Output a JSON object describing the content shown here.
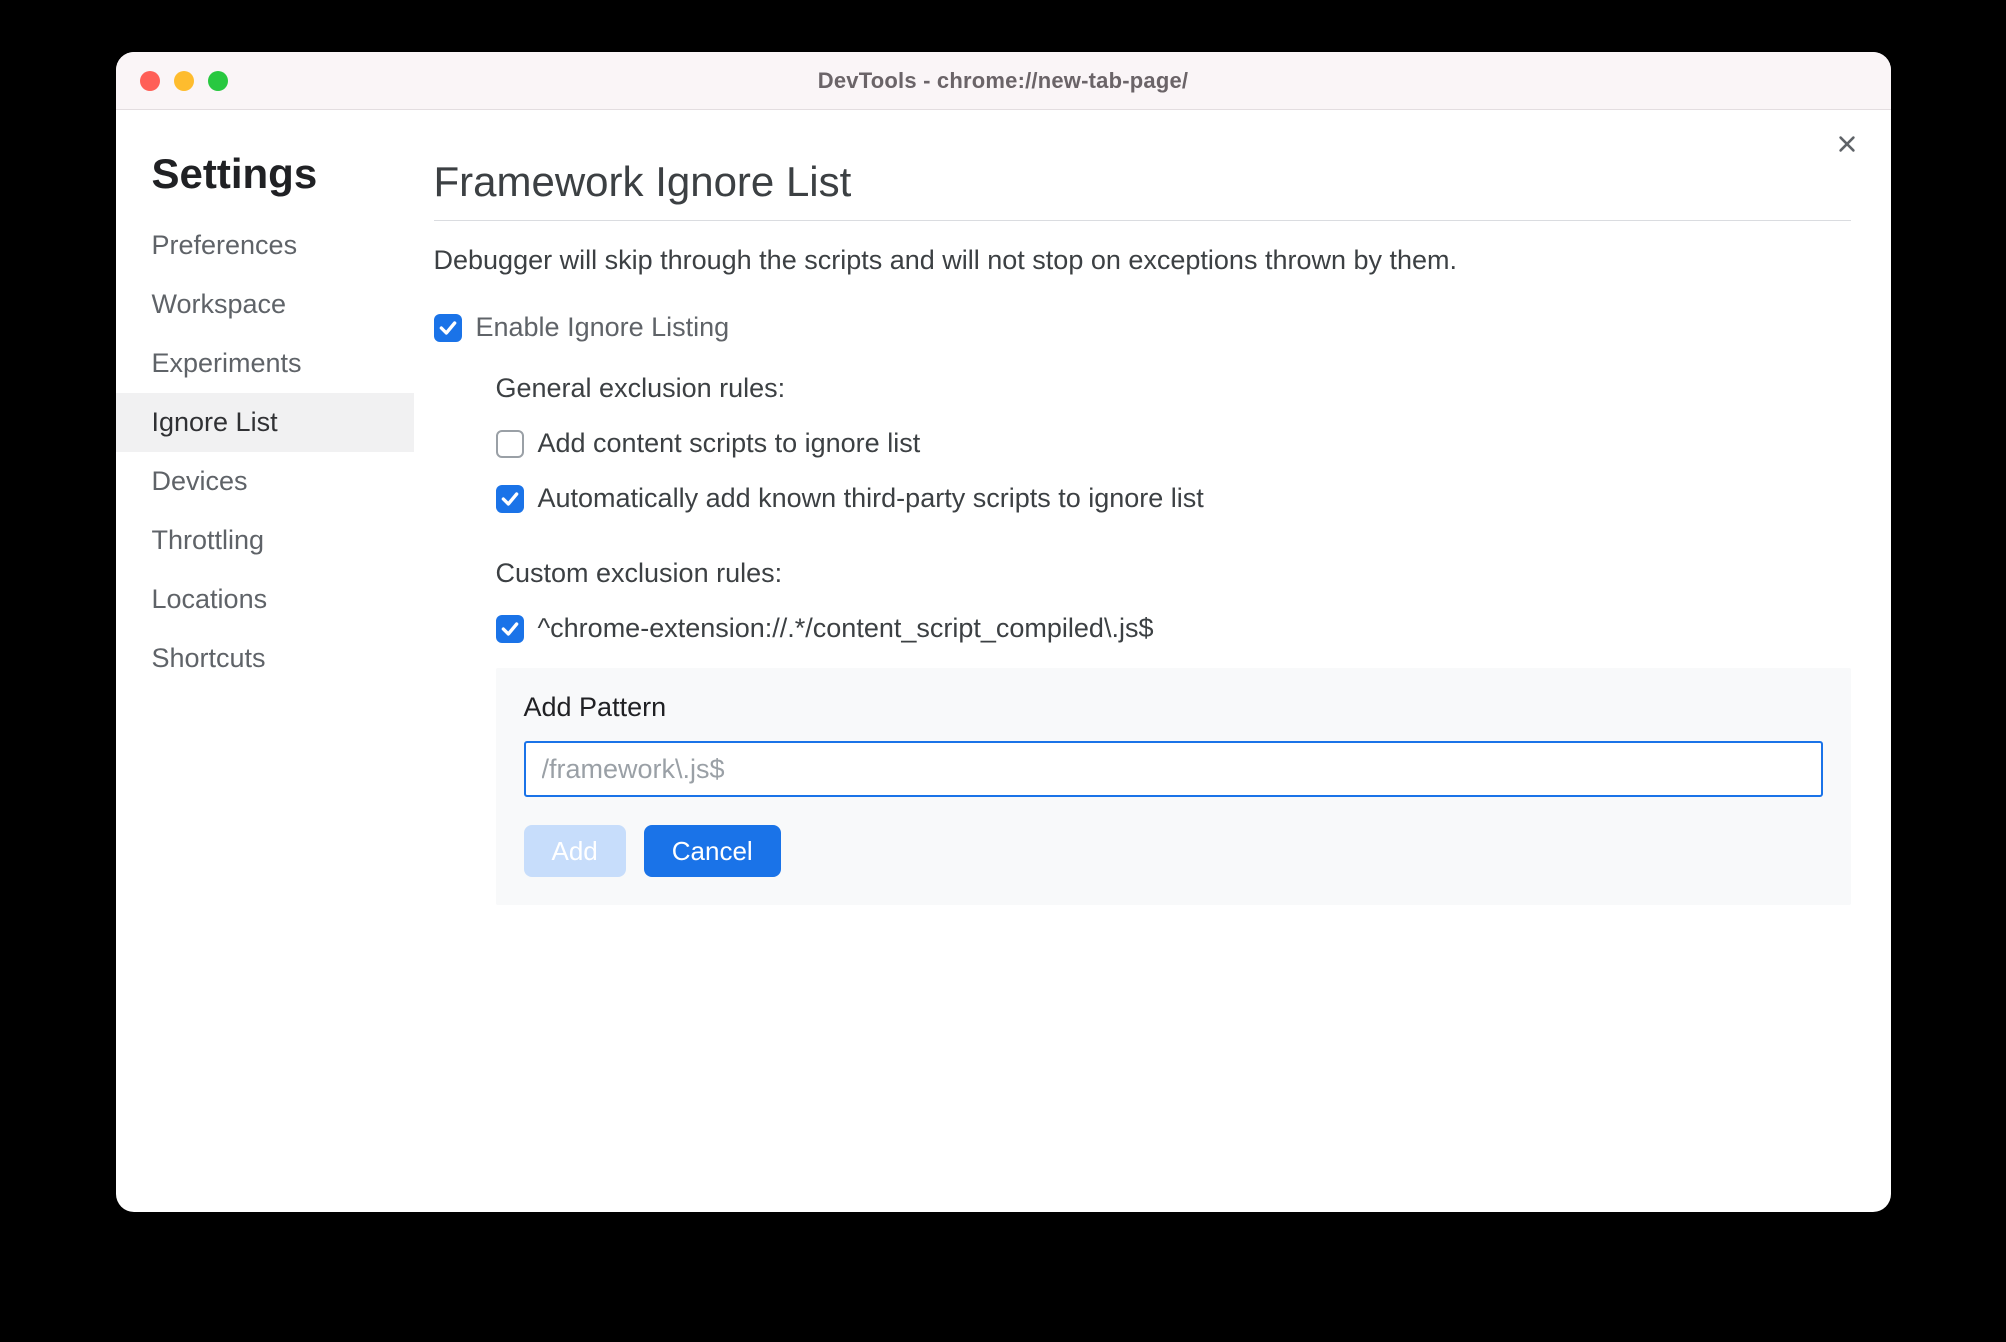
{
  "titlebar": {
    "title": "DevTools - chrome://new-tab-page/"
  },
  "sidebar": {
    "heading": "Settings",
    "items": [
      {
        "label": "Preferences",
        "active": false
      },
      {
        "label": "Workspace",
        "active": false
      },
      {
        "label": "Experiments",
        "active": false
      },
      {
        "label": "Ignore List",
        "active": true
      },
      {
        "label": "Devices",
        "active": false
      },
      {
        "label": "Throttling",
        "active": false
      },
      {
        "label": "Locations",
        "active": false
      },
      {
        "label": "Shortcuts",
        "active": false
      }
    ]
  },
  "main": {
    "heading": "Framework Ignore List",
    "description": "Debugger will skip through the scripts and will not stop on exceptions thrown by them.",
    "enable": {
      "label": "Enable Ignore Listing",
      "checked": true
    },
    "general": {
      "heading": "General exclusion rules:",
      "rules": [
        {
          "label": "Add content scripts to ignore list",
          "checked": false
        },
        {
          "label": "Automatically add known third-party scripts to ignore list",
          "checked": true
        }
      ]
    },
    "custom": {
      "heading": "Custom exclusion rules:",
      "rules": [
        {
          "label": "^chrome-extension://.*/content_script_compiled\\.js$",
          "checked": true
        }
      ]
    },
    "addPanel": {
      "heading": "Add Pattern",
      "placeholder": "/framework\\.js$",
      "value": "",
      "addLabel": "Add",
      "cancelLabel": "Cancel"
    }
  }
}
